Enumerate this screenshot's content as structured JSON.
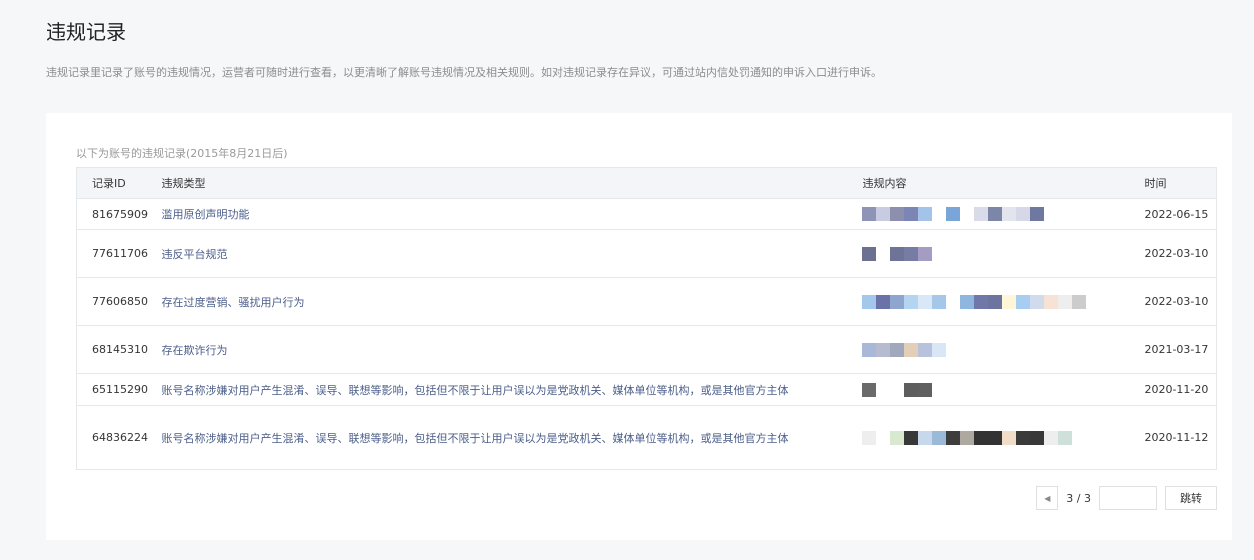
{
  "header": {
    "title": "违规记录",
    "description": "违规记录里记录了账号的违规情况，运营者可随时进行查看，以更清晰了解账号违规情况及相关规则。如对违规记录存在异议，可通过站内信处罚通知的申诉入口进行申诉。"
  },
  "records": {
    "subtitle": "以下为账号的违规记录(2015年8月21日后)",
    "columns": [
      "记录ID",
      "违规类型",
      "违规内容",
      "时间"
    ],
    "rows": [
      {
        "id": "81675909",
        "type": "滥用原创声明功能",
        "time": "2022-06-15"
      },
      {
        "id": "77611706",
        "type": "违反平台规范",
        "time": "2022-03-10"
      },
      {
        "id": "77606850",
        "type": "存在过度营销、骚扰用户行为",
        "time": "2022-03-10"
      },
      {
        "id": "68145310",
        "type": "存在欺诈行为",
        "time": "2021-03-17"
      },
      {
        "id": "65115290",
        "type": "账号名称涉嫌对用户产生混淆、误导、联想等影响，包括但不限于让用户误以为是党政机关、媒体单位等机构，或是其他官方主体",
        "time": "2020-11-20"
      },
      {
        "id": "64836224",
        "type": "账号名称涉嫌对用户产生混淆、误导、联想等影响，包括但不限于让用户误以为是党政机关、媒体单位等机构，或是其他官方主体",
        "time": "2020-11-12"
      }
    ]
  },
  "pagination": {
    "page_info": "3 / 3",
    "jump_input": "",
    "jump_label": "跳转"
  }
}
